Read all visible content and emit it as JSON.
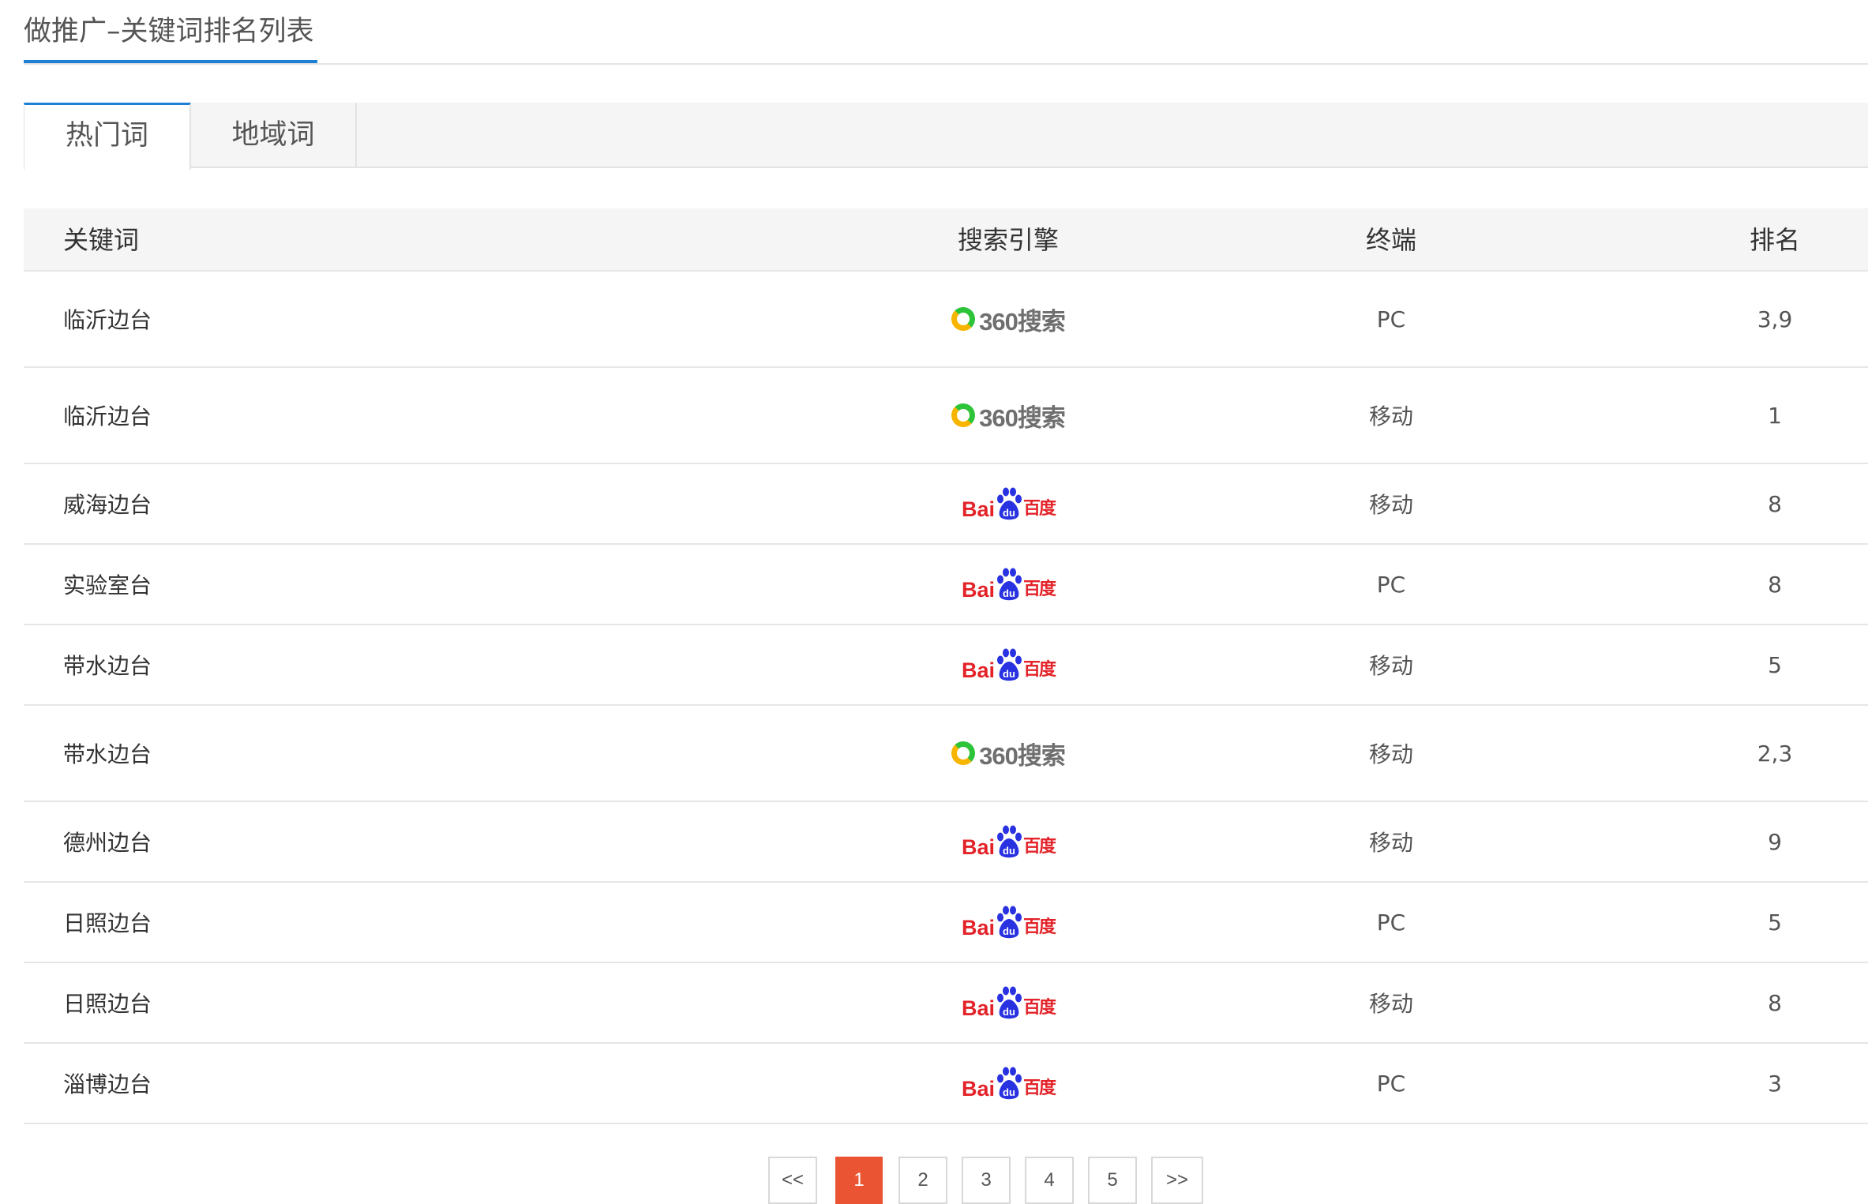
{
  "header": {
    "title": "做推广–关键词排名列表"
  },
  "tabs": [
    {
      "label": "热门词",
      "active": true
    },
    {
      "label": "地域词",
      "active": false
    }
  ],
  "table": {
    "columns": [
      "关键词",
      "搜索引擎",
      "终端",
      "排名"
    ],
    "rows": [
      {
        "keyword": "临沂边台",
        "engine": "360",
        "engine_text": "360搜索",
        "terminal": "PC",
        "rank": "3,9"
      },
      {
        "keyword": "临沂边台",
        "engine": "360",
        "engine_text": "360搜索",
        "terminal": "移动",
        "rank": "1"
      },
      {
        "keyword": "威海边台",
        "engine": "baidu",
        "engine_text": "Bai百度",
        "terminal": "移动",
        "rank": "8"
      },
      {
        "keyword": "实验室台",
        "engine": "baidu",
        "engine_text": "Bai百度",
        "terminal": "PC",
        "rank": "8"
      },
      {
        "keyword": "带水边台",
        "engine": "baidu",
        "engine_text": "Bai百度",
        "terminal": "移动",
        "rank": "5"
      },
      {
        "keyword": "带水边台",
        "engine": "360",
        "engine_text": "360搜索",
        "terminal": "移动",
        "rank": "2,3"
      },
      {
        "keyword": "德州边台",
        "engine": "baidu",
        "engine_text": "Bai百度",
        "terminal": "移动",
        "rank": "9"
      },
      {
        "keyword": "日照边台",
        "engine": "baidu",
        "engine_text": "Bai百度",
        "terminal": "PC",
        "rank": "5"
      },
      {
        "keyword": "日照边台",
        "engine": "baidu",
        "engine_text": "Bai百度",
        "terminal": "移动",
        "rank": "8"
      },
      {
        "keyword": "淄博边台",
        "engine": "baidu",
        "engine_text": "Bai百度",
        "terminal": "PC",
        "rank": "3"
      }
    ]
  },
  "pagination": {
    "prev_label": "<<",
    "pages": [
      "1",
      "2",
      "3",
      "4",
      "5"
    ],
    "current": "1",
    "next_label": ">>"
  },
  "colors": {
    "accent": "#1e7fd4",
    "page_active": "#ea5432",
    "baidu_red": "#e32329",
    "baidu_blue": "#2932e1",
    "so360_green": "#2ec43a",
    "so360_orange": "#f7b500"
  },
  "icons": {
    "so360": "so360-logo-icon",
    "baidu": "baidu-logo-icon"
  }
}
